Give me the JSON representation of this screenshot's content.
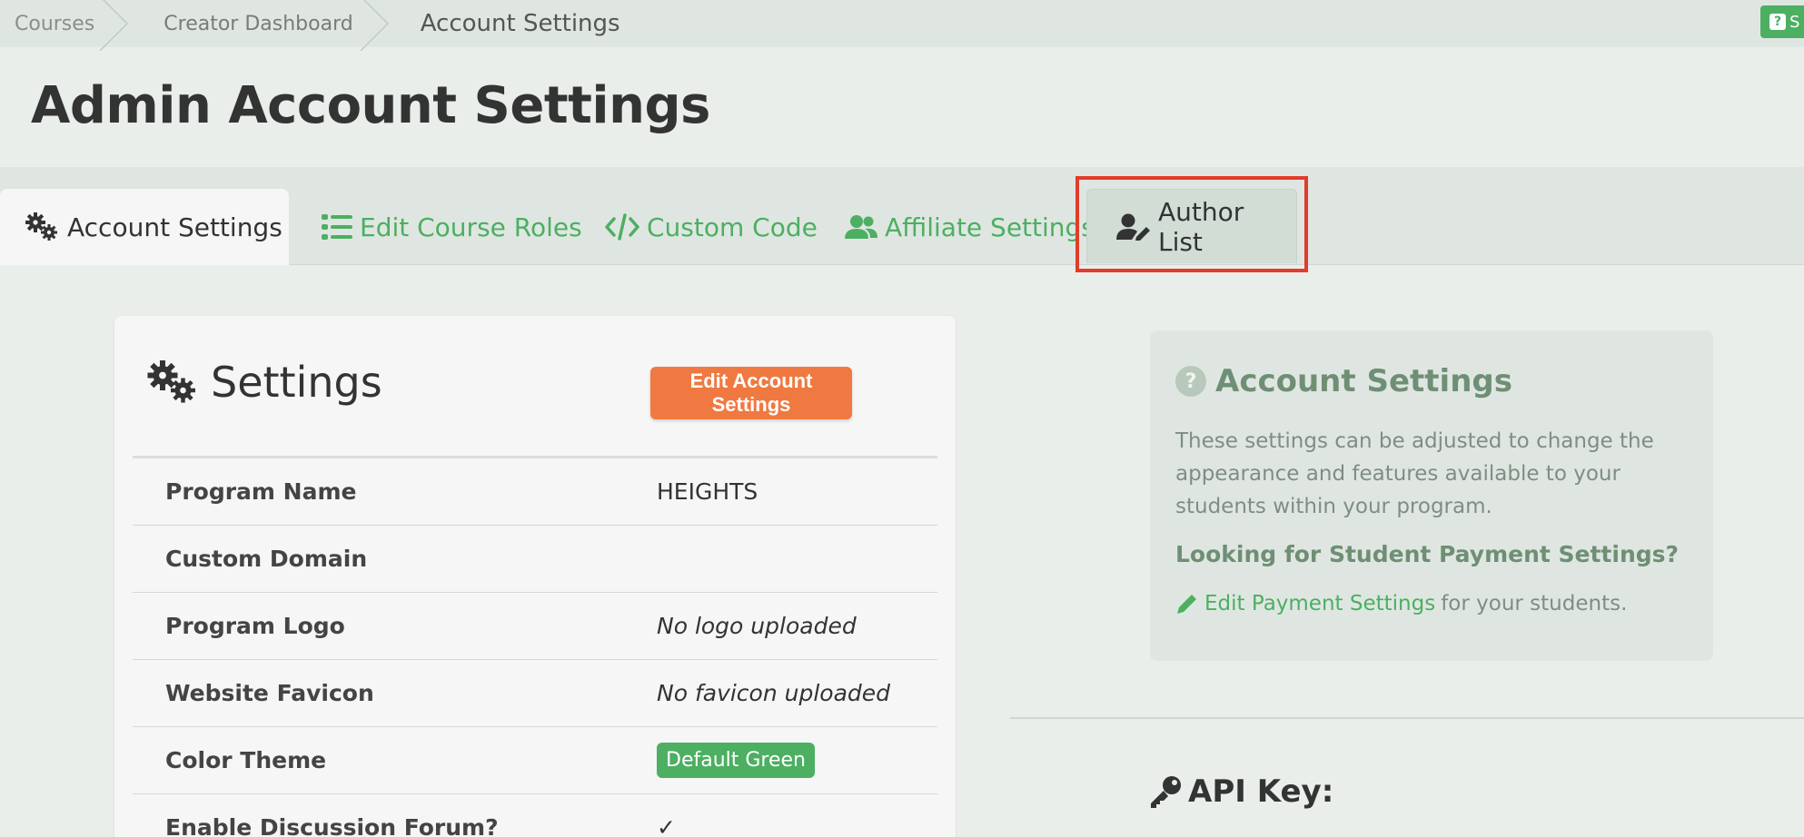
{
  "breadcrumb": {
    "items": [
      {
        "label": "Courses"
      },
      {
        "label": "Creator Dashboard"
      },
      {
        "label": "Account Settings"
      }
    ]
  },
  "help_chip": {
    "letter": "S"
  },
  "page_title": "Admin Account Settings",
  "tabs": [
    {
      "label": "Account Settings",
      "icon": "gears-icon"
    },
    {
      "label": "Edit Course Roles",
      "icon": "list-icon"
    },
    {
      "label": "Custom Code",
      "icon": "code-icon"
    },
    {
      "label": "Affiliate Settings",
      "icon": "users-icon"
    },
    {
      "label": "Author List",
      "icon": "user-edit-icon"
    }
  ],
  "settings_card": {
    "title": "Settings",
    "edit_button": "Edit Account Settings",
    "rows": [
      {
        "key": "Program Name",
        "value": "HEIGHTS"
      },
      {
        "key": "Custom Domain",
        "value": ""
      },
      {
        "key": "Program Logo",
        "value": "No logo uploaded"
      },
      {
        "key": "Website Favicon",
        "value": "No favicon uploaded"
      },
      {
        "key": "Color Theme",
        "value": "Default Green"
      },
      {
        "key": "Enable Discussion Forum?",
        "value": "✓"
      }
    ]
  },
  "info_panel": {
    "title": "Account Settings",
    "description": "These settings can be adjusted to change the appearance and features available to your students within your program.",
    "subheading": "Looking for Student Payment Settings?",
    "link_label": "Edit Payment Settings",
    "link_suffix": "for your students."
  },
  "api_section": {
    "title": "API Key:"
  },
  "colors": {
    "accent": "#4caf62",
    "button": "#ef7940",
    "highlight": "#e23c2a"
  }
}
